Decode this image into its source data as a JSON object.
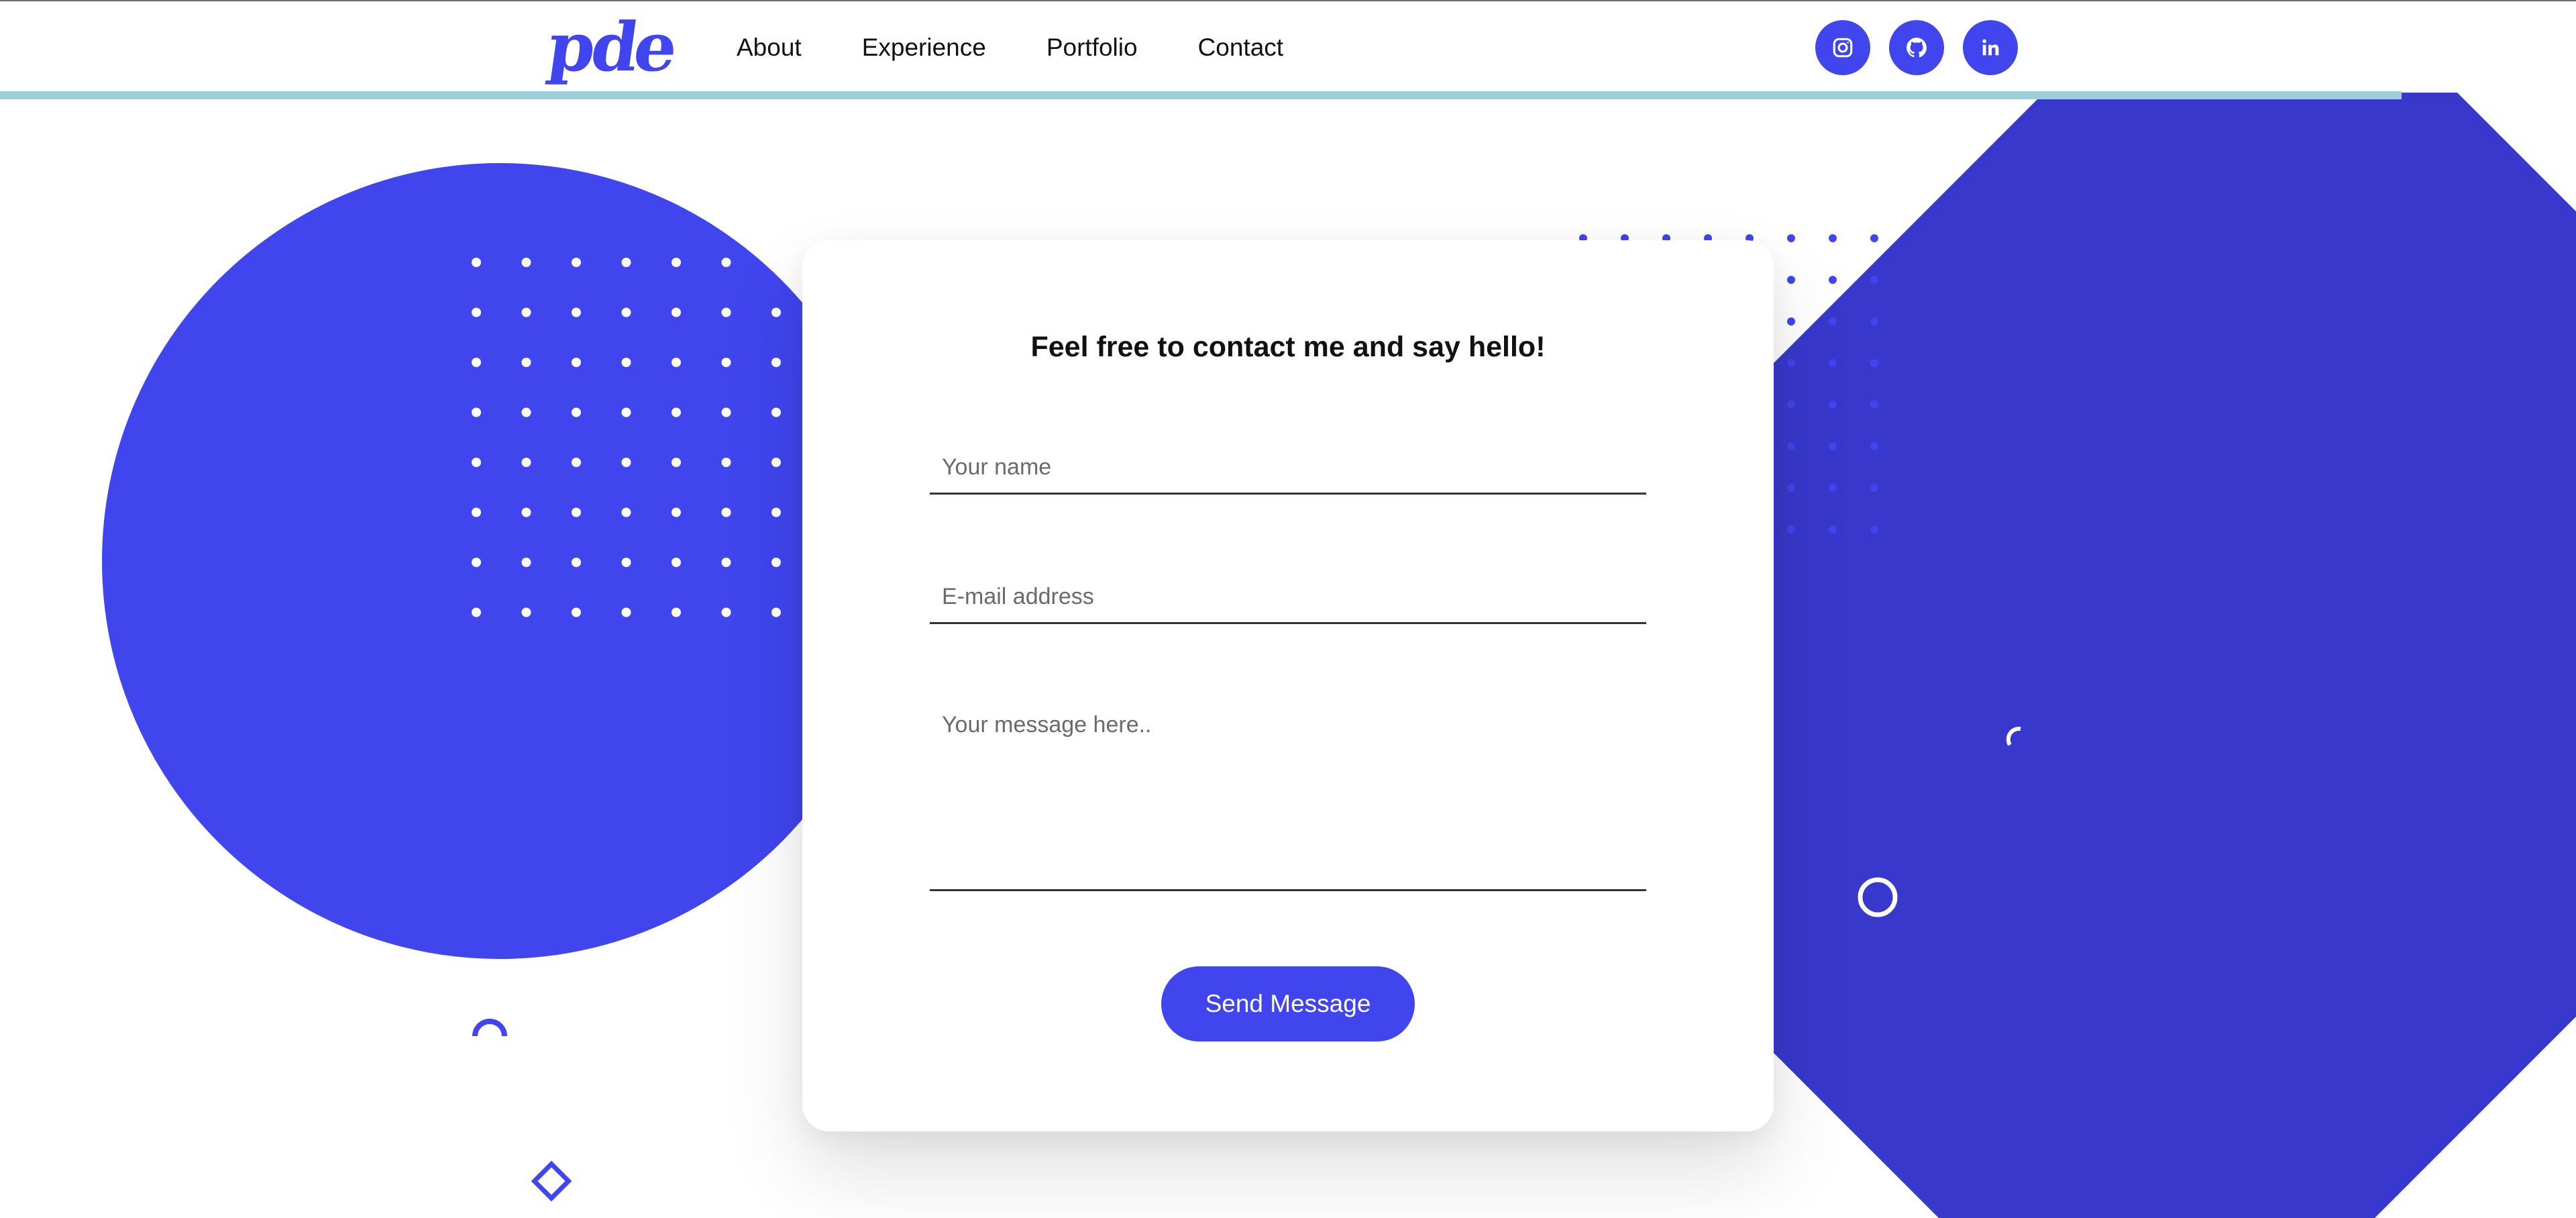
{
  "colors": {
    "accent": "#4045ee",
    "accent_dark": "#3838cc",
    "nav_stripe": "#9acfd8",
    "text": "#111111"
  },
  "navbar": {
    "logo_text": "pde",
    "links": [
      {
        "label": "About"
      },
      {
        "label": "Experience"
      },
      {
        "label": "Portfolio"
      },
      {
        "label": "Contact"
      }
    ],
    "social": [
      {
        "icon": "instagram-icon"
      },
      {
        "icon": "github-icon"
      },
      {
        "icon": "linkedin-icon"
      }
    ]
  },
  "contact": {
    "title": "Feel free to contact me and say hello!",
    "name_placeholder": "Your name",
    "email_placeholder": "E-mail address",
    "message_placeholder": "Your message here..",
    "submit_label": "Send Message"
  }
}
